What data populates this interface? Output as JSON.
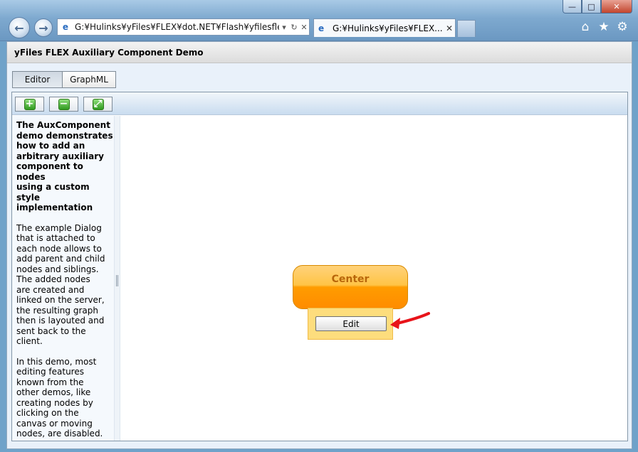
{
  "browser": {
    "address_url": "G:¥Hulinks¥yFiles¥FLEX¥dot.NET¥Flash¥yfilesfle",
    "address_tools": [
      "▾",
      "↻",
      "✕"
    ],
    "active_tab_title": "G:¥Hulinks¥yFiles¥FLEX...",
    "active_tab_close": "✕",
    "window_controls": {
      "minimize": "—",
      "maximize": "□",
      "close": "✕"
    },
    "icons": {
      "home": "⌂",
      "favorites": "★",
      "tools": "⚙",
      "back": "←",
      "forward": "→",
      "ie": "e"
    }
  },
  "app": {
    "title": "yFiles FLEX Auxiliary Component Demo",
    "view_tabs": [
      {
        "label": "Editor",
        "selected": true
      },
      {
        "label": "GraphML",
        "selected": false
      }
    ],
    "toolbar": {
      "zoom_in_glyph": "+",
      "zoom_out_glyph": "−",
      "fit_glyph": "⤢"
    },
    "sidebar": {
      "intro": "The AuxComponent\ndemo demonstrates\nhow to add an\narbitrary auxiliary\ncomponent to nodes\nusing a custom\nstyle\nimplementation",
      "paragraph1": " The example Dialog\nthat is attached to\neach node allows to\nadd parent and child\nnodes and siblings.\n The added nodes\nare created and\nlinked on the server,\nthe resulting graph\nthen is layouted and\nsent back to the\nclient.",
      "paragraph2": " In this demo, most\nediting features\nknown from the\nother demos, like\ncreating nodes by\nclicking on the\ncanvas or moving\nnodes, are disabled."
    },
    "canvas": {
      "node_label": "Center",
      "edit_button_label": "Edit"
    }
  },
  "colors": {
    "node_top": "#ffd27a",
    "node_bottom": "#ff8c00",
    "node_label": "#b8660a",
    "aux_fill": "#fddd7d",
    "annotation_arrow": "#e8141a"
  }
}
